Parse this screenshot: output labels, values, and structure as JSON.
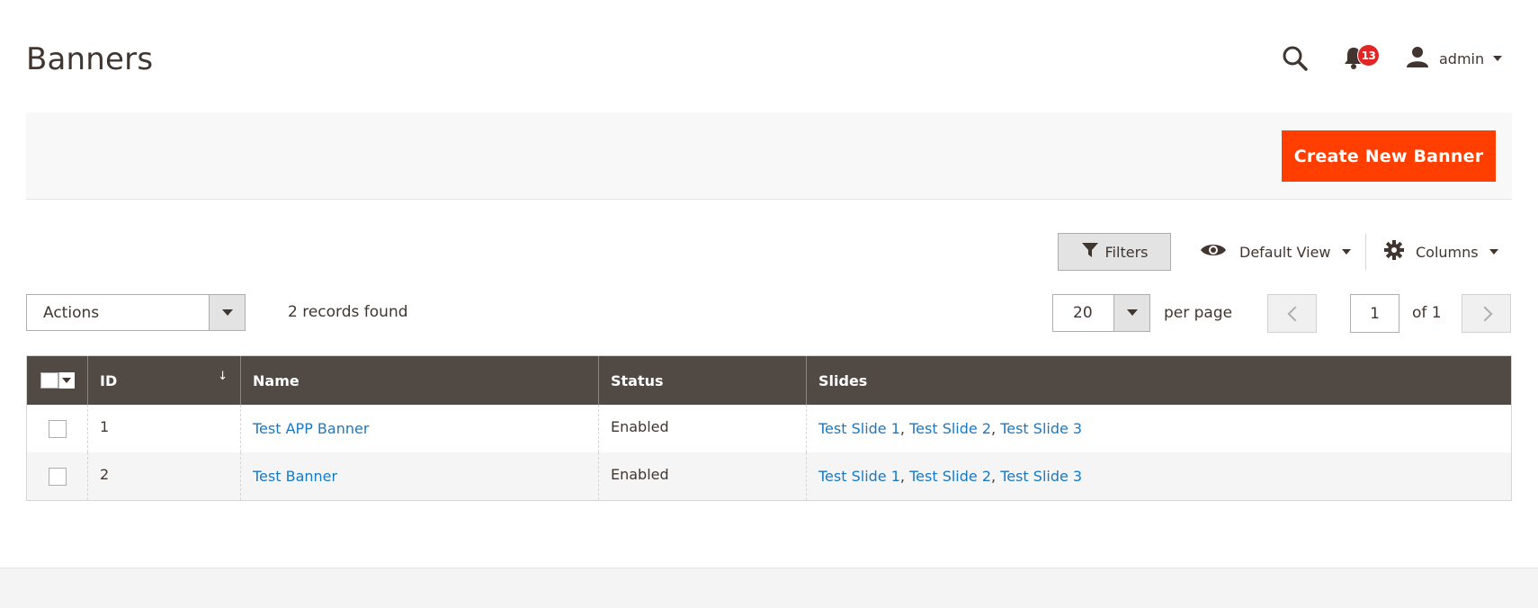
{
  "header": {
    "title": "Banners",
    "notification_count": "13",
    "user_name": "admin"
  },
  "action_bar": {
    "create_label": "Create New Banner"
  },
  "toolbar": {
    "filters_label": "Filters",
    "view_label": "Default View",
    "columns_label": "Columns",
    "actions_label": "Actions",
    "records_found": "2 records found",
    "per_page_value": "20",
    "per_page_label": "per page",
    "current_page": "1",
    "total_pages_label": "of 1"
  },
  "grid": {
    "columns": [
      "ID",
      "Name",
      "Status",
      "Slides"
    ],
    "sort_indicator": "↓",
    "rows": [
      {
        "id": "1",
        "name": "Test APP Banner",
        "status": "Enabled",
        "slides": [
          "Test Slide 1",
          "Test Slide 2",
          "Test Slide 3"
        ]
      },
      {
        "id": "2",
        "name": "Test Banner",
        "status": "Enabled",
        "slides": [
          "Test Slide 1",
          "Test Slide 2",
          "Test Slide 3"
        ]
      }
    ],
    "slide_separator": ","
  },
  "colors": {
    "primary_button": "#ff3e00",
    "grid_header": "#514943",
    "link": "#1979c3",
    "badge": "#e22626"
  },
  "icons": [
    "search-icon",
    "bell-icon",
    "user-icon",
    "filter-icon",
    "eye-icon",
    "gear-icon"
  ]
}
